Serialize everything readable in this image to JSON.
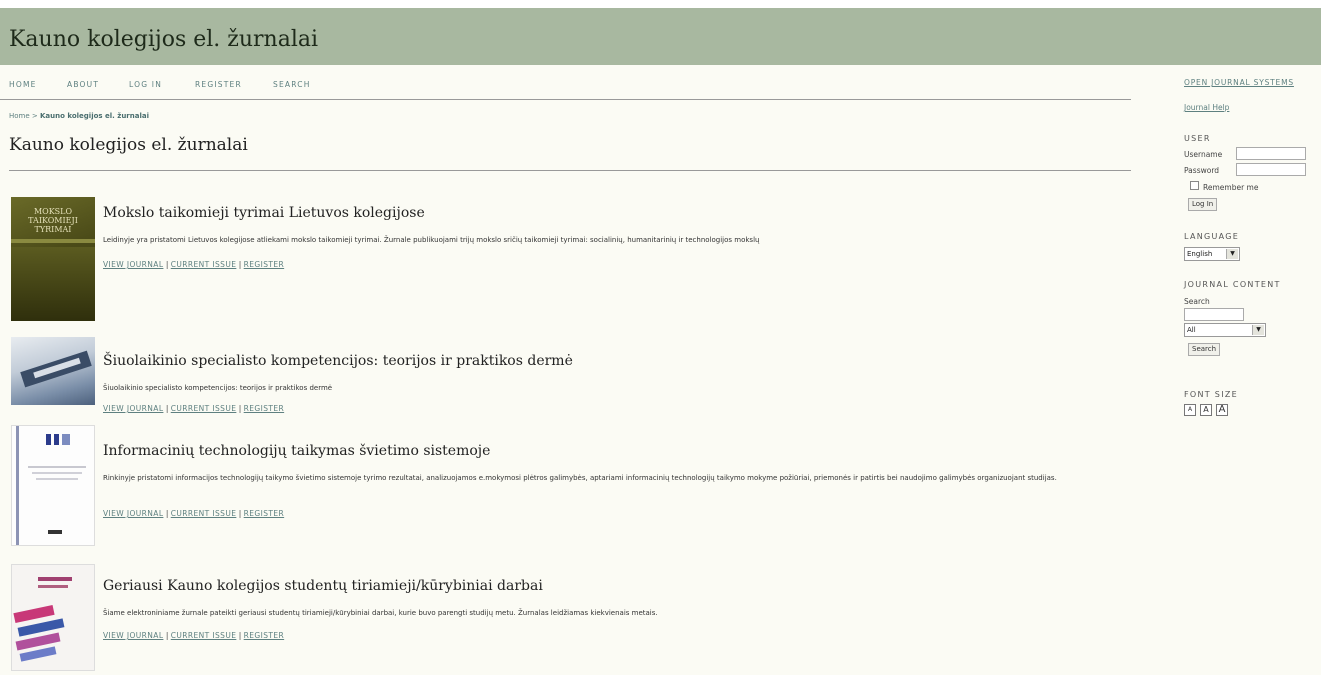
{
  "site_title": "Kauno kolegijos el. žurnalai",
  "nav": [
    "HOME",
    "ABOUT",
    "LOG IN",
    "REGISTER",
    "SEARCH"
  ],
  "breadcrumb": {
    "home": "Home",
    "sep": " > ",
    "current": "Kauno kolegijos el. žurnalai"
  },
  "page_title": "Kauno kolegijos el. žurnalai",
  "journals": [
    {
      "title": "Mokslo taikomieji tyrimai Lietuvos kolegijose",
      "description": "Leidinyje yra pristatomi Lietuvos kolegijose atliekami mokslo taikomieji tyrimai. Žurnale publikuojami trijų mokslo sričių taikomieji tyrimai: socialinių, humanitarinių ir technologijos mokslų",
      "cover_text": [
        "MOKSLO",
        "TAIKOMIEJI",
        "TYRIMAI"
      ]
    },
    {
      "title": "Šiuolaikinio specialisto kompetencijos: teorijos ir praktikos dermė",
      "description": "Šiuolaikinio specialisto kompetencijos: teorijos ir praktikos dermė"
    },
    {
      "title": "Informacinių technologijų taikymas švietimo sistemoje",
      "description": "Rinkinyje pristatomi informacijos technologijų taikymo švietimo sistemoje tyrimo rezultatai, analizuojamos e.mokymosi plėtros galimybės, aptariami informacinių technologijų taikymo mokyme požiūriai, priemonės ir patirtis bei naudojimo galimybės organizuojant studijas."
    },
    {
      "title": "Geriausi Kauno kolegijos studentų tiriamieji/kūrybiniai darbai",
      "description": "Šiame elektroniniame žurnale pateikti geriausi studentų tiriamieji/kūrybiniai darbai, kurie buvo parengti studijų metu. Žurnalas leidžiamas kiekvienais metais."
    }
  ],
  "journal_links": {
    "view": "VIEW JOURNAL",
    "current": "CURRENT ISSUE",
    "register": "REGISTER",
    "sep": "|"
  },
  "sidebar": {
    "ojs": "OPEN JOURNAL SYSTEMS",
    "help": "Journal Help",
    "user_heading": "USER",
    "username_label": "Username",
    "password_label": "Password",
    "remember_label": "Remember me",
    "login_button": "Log In",
    "language_heading": "LANGUAGE",
    "language_value": "English",
    "content_heading": "JOURNAL CONTENT",
    "search_label": "Search",
    "scope_value": "All",
    "search_button": "Search",
    "font_heading": "FONT SIZE",
    "font_sizes": [
      "A",
      "A",
      "A"
    ]
  },
  "colors": {
    "header": "#a8b8a0",
    "link": "#5e8080",
    "page_bg": "#fbfbf4"
  }
}
